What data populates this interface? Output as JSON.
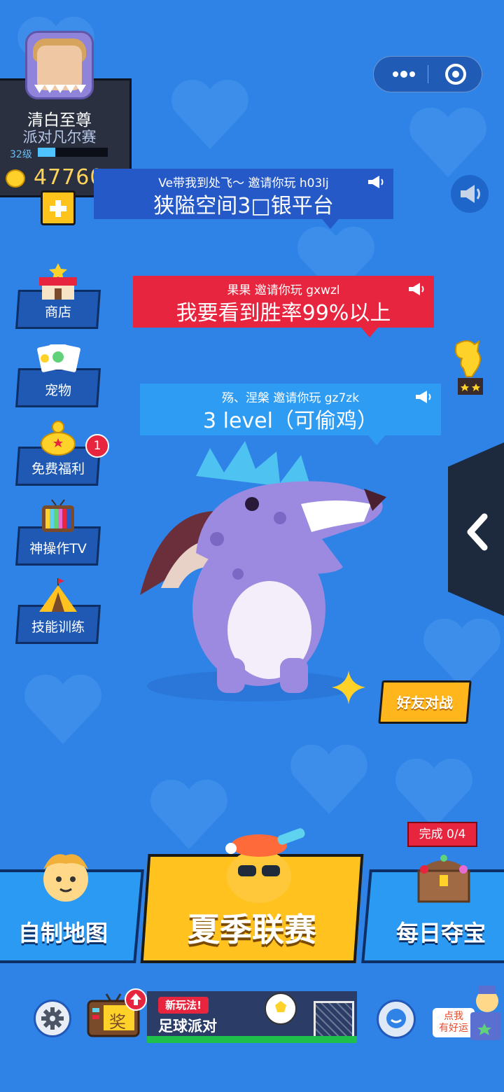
{
  "profile": {
    "nickname": "清白至尊",
    "rank_title": "派对凡尔赛",
    "level": "32级",
    "level_progress": 0.25,
    "coins": "47760"
  },
  "capsule": {
    "more_icon": "ellipsis-icon",
    "close_icon": "target-close-icon"
  },
  "invites": [
    {
      "header": "Ve带我到处飞～ 邀请你玩 h03lj",
      "message": "狭隘空间3□银平台",
      "color": "#2659c8"
    },
    {
      "header": "果果 邀请你玩 gxwzl",
      "message": "我要看到胜率99%以上",
      "color": "#e8253e"
    },
    {
      "header": "殇、涅槃 邀请你玩 gz7zk",
      "message": "3  level（可偷鸡）",
      "color": "#2f9cf3"
    }
  ],
  "left_menu": [
    {
      "label": "商店",
      "icon": "shop-icon"
    },
    {
      "label": "宠物",
      "icon": "pet-cards-icon"
    },
    {
      "label": "免费福利",
      "icon": "piggy-bank-icon",
      "badge": "1"
    },
    {
      "label": "神操作TV",
      "icon": "tv-icon"
    },
    {
      "label": "技能训练",
      "icon": "tent-icon"
    }
  ],
  "friend_battle": "好友对战",
  "modes": {
    "left": "自制地图",
    "center": "夏季联赛",
    "right": "每日夺宝",
    "right_progress": "完成 0/4"
  },
  "bottom_bar": {
    "reward_label": "奖",
    "ad_tag": "新玩法!",
    "ad_title": "足球派对",
    "luck_label_line1": "点我",
    "luck_label_line2": "有好运"
  },
  "colors": {
    "background": "#2f83e6",
    "accent_yellow": "#ffc21e",
    "accent_red": "#e8253e"
  }
}
